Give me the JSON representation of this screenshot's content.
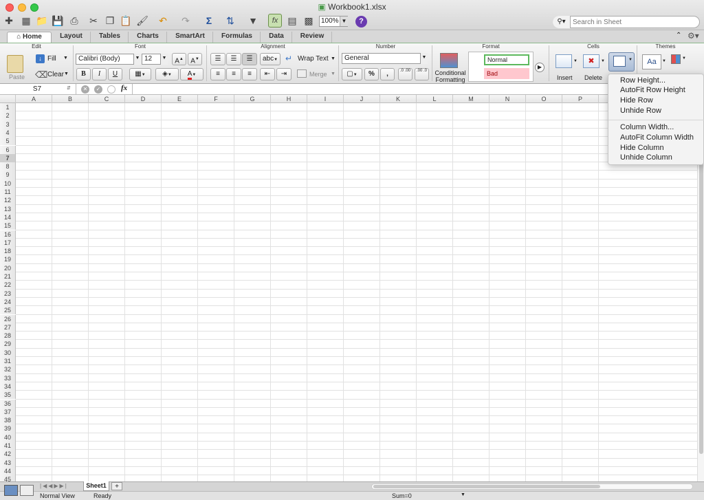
{
  "window": {
    "title": "Workbook1.xlsx"
  },
  "toolbar": {
    "zoom": "100%",
    "help": "?",
    "search_placeholder": "Search in Sheet",
    "search_icon": "magnifier-icon"
  },
  "tabs": [
    {
      "label": "Home",
      "active": true
    },
    {
      "label": "Layout"
    },
    {
      "label": "Tables"
    },
    {
      "label": "Charts"
    },
    {
      "label": "SmartArt"
    },
    {
      "label": "Formulas"
    },
    {
      "label": "Data"
    },
    {
      "label": "Review"
    }
  ],
  "ribbon": {
    "groups": {
      "edit": "Edit",
      "font": "Font",
      "alignment": "Alignment",
      "number": "Number",
      "format": "Format",
      "cells": "Cells",
      "themes": "Themes"
    },
    "edit": {
      "paste": "Paste",
      "fill": "Fill",
      "clear": "Clear"
    },
    "font": {
      "name": "Calibri (Body)",
      "size": "12",
      "bold": "B",
      "italic": "I",
      "underline": "U",
      "grow": "A",
      "shrink": "A",
      "color_letter": "A"
    },
    "alignment": {
      "orientation": "abc",
      "wrap_text": "Wrap Text",
      "merge": "Merge"
    },
    "number": {
      "format": "General",
      "percent": "%",
      "comma": ",",
      "inc_decimal": ".0\n.00",
      "dec_decimal": ".00\n.0"
    },
    "format": {
      "conditional": "Conditional\nFormatting",
      "style_normal": "Normal",
      "style_bad": "Bad"
    },
    "cells": {
      "insert": "Insert",
      "delete": "Delete"
    },
    "themes": {
      "aa": "Aa"
    }
  },
  "formula_bar": {
    "name_box": "S7",
    "fx": "fx",
    "formula": ""
  },
  "columns": [
    "A",
    "B",
    "C",
    "D",
    "E",
    "F",
    "G",
    "H",
    "I",
    "J",
    "K",
    "L",
    "M",
    "N",
    "O",
    "P"
  ],
  "rows": [
    "1",
    "2",
    "3",
    "4",
    "5",
    "6",
    "7",
    "8",
    "9",
    "10",
    "11",
    "12",
    "13",
    "14",
    "15",
    "16",
    "17",
    "18",
    "19",
    "20",
    "21",
    "22",
    "23",
    "24",
    "25",
    "26",
    "27",
    "28",
    "29",
    "30",
    "31",
    "32",
    "33",
    "34",
    "35",
    "36",
    "37",
    "38",
    "39",
    "40",
    "41",
    "42",
    "43",
    "44",
    "45"
  ],
  "selected_row": "7",
  "sheet_tabs": [
    {
      "label": "Sheet1",
      "active": true
    }
  ],
  "add_sheet": "+",
  "status": {
    "view": "Normal View",
    "state": "Ready",
    "sum": "Sum=0"
  },
  "format_menu": {
    "row_items": [
      "Row Height...",
      "AutoFit Row Height",
      "Hide Row",
      "Unhide Row"
    ],
    "column_items": [
      "Column Width...",
      "AutoFit Column Width",
      "Hide Column",
      "Unhide Column"
    ]
  },
  "colors": {
    "ribbon_accent": "#8bb88b",
    "bad_fill": "#ffc7ce",
    "bad_text": "#9c0006",
    "normal_border": "#5cb85c",
    "help": "#6a3bb0",
    "selected_header": "#cfcfcf"
  }
}
